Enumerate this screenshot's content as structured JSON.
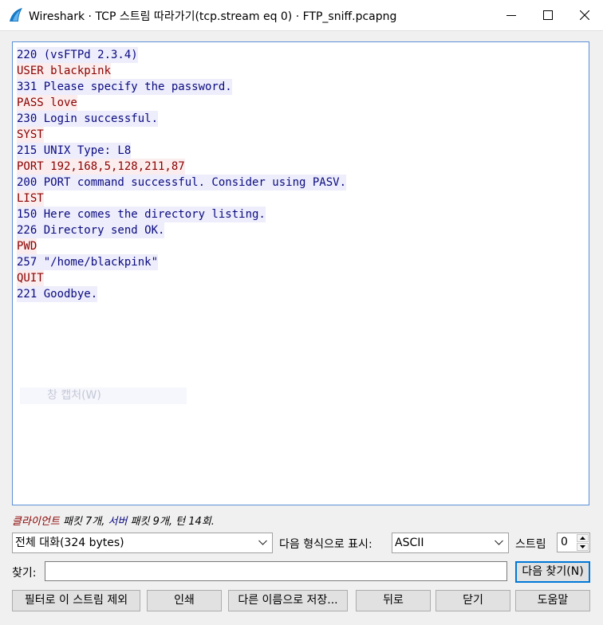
{
  "window": {
    "title": "Wireshark · TCP 스트림 따라가기(tcp.stream eq 0) · FTP_sniff.pcapng",
    "icons": [
      "wireshark-fin-icon",
      "minimize-icon",
      "maximize-icon",
      "close-icon"
    ]
  },
  "stream": {
    "lines": [
      {
        "role": "server",
        "text": "220 (vsFTPd 2.3.4)"
      },
      {
        "role": "client",
        "text": "USER blackpink"
      },
      {
        "role": "server",
        "text": "331 Please specify the password."
      },
      {
        "role": "client",
        "text": "PASS love"
      },
      {
        "role": "server",
        "text": "230 Login successful."
      },
      {
        "role": "client",
        "text": "SYST"
      },
      {
        "role": "server",
        "text": "215 UNIX Type: L8"
      },
      {
        "role": "client",
        "text": "PORT 192,168,5,128,211,87"
      },
      {
        "role": "server",
        "text": "200 PORT command successful. Consider using PASV."
      },
      {
        "role": "client",
        "text": "LIST"
      },
      {
        "role": "server",
        "text": "150 Here comes the directory listing."
      },
      {
        "role": "server",
        "text": "226 Directory send OK."
      },
      {
        "role": "client",
        "text": "PWD"
      },
      {
        "role": "server",
        "text": "257 \"/home/blackpink\""
      },
      {
        "role": "client",
        "text": "QUIT"
      },
      {
        "role": "server",
        "text": "221 Goodbye."
      }
    ],
    "ghost_text": "창 캡처(W)"
  },
  "stats": {
    "client_label": "클라이언트",
    "client_text": " 패킷 7개, ",
    "server_label": "서버",
    "server_text": " 패킷 9개, 턴 14회."
  },
  "controls": {
    "conversation_value": "전체 대화(324 bytes)",
    "show_as_label": "다음 형식으로 표시:",
    "show_as_value": "ASCII",
    "stream_label": "스트림",
    "stream_value": "0",
    "find_label": "찾기:",
    "find_value": "",
    "find_next_label": "다음 찾기(N)"
  },
  "buttons": {
    "filter_out": "필터로 이 스트림 제외",
    "print": "인쇄",
    "save_as": "다른 이름으로 저장...",
    "back": "뒤로",
    "close": "닫기",
    "help": "도움말"
  },
  "colors": {
    "client_text": "#8b0000",
    "client_bg": "#fbeded",
    "server_text": "#0a0a80",
    "server_bg": "#ededfb",
    "accent": "#0078d7"
  }
}
